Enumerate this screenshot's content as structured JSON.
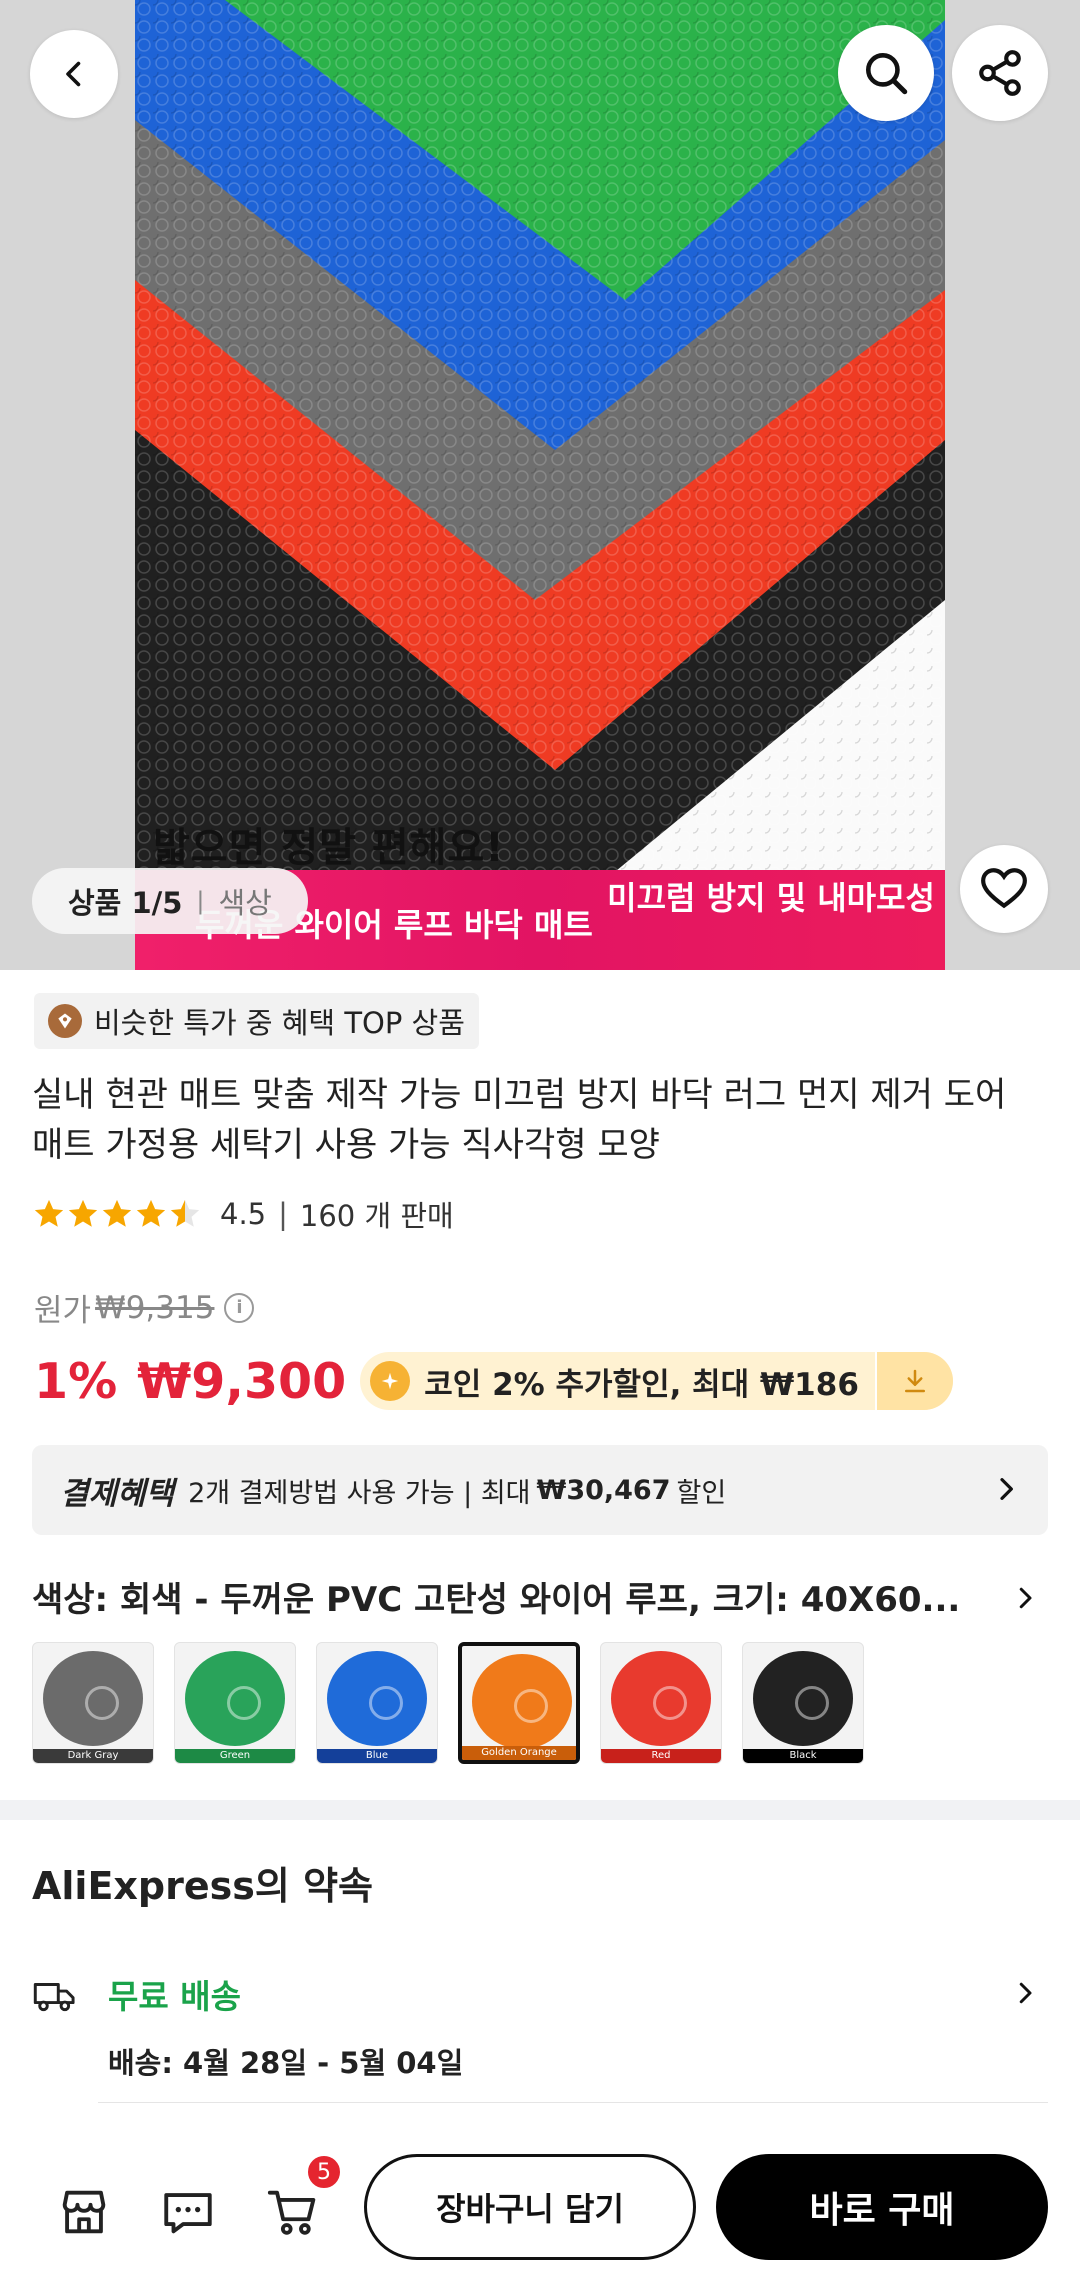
{
  "hero": {
    "overlay_text": "밟으면 정말 편해요!",
    "banner_left": "두꺼운 와이어 루프 바닥 매트",
    "banner_right": "미끄럼 방지 및 내마모성",
    "counter_current": "상품 1/5",
    "counter_other": "색상",
    "mat_colors": [
      "#2bb24a",
      "#1e63d6",
      "#6f6f6f",
      "#ef3b23",
      "#202020"
    ]
  },
  "product": {
    "tag": "비슷한 특가 중 혜택 TOP 상품",
    "title": "실내 현관 매트 맞춤 제작 가능 미끄럼 방지 바닥 러그 먼지 제거 도어 매트 가정용 세탁기 사용 가능 직사각형 모양",
    "rating": "4.5",
    "rating_stars": 4.5,
    "sold": "160 개 판매",
    "original_label": "원가",
    "original_price": "₩9,315",
    "discount": "1%",
    "price": "₩9,300",
    "coin_text": "코인 2% 추가할인, 최대 ₩186"
  },
  "payment": {
    "title": "결제혜택",
    "text": "2개 결제방법 사용 가능 | 최대",
    "amount": "₩30,467",
    "suffix": "할인"
  },
  "variant": {
    "label": "색상: 회색 - 두꺼운 PVC 고탄성 와이어 루프, 크기: 40X60...",
    "swatches": [
      {
        "name": "Dark Gray",
        "color": "#6b6b6b",
        "cap": "#3a3a3a"
      },
      {
        "name": "Green",
        "color": "#29a35a",
        "cap": "#1d8a45"
      },
      {
        "name": "Blue",
        "color": "#1f6bd9",
        "cap": "#14409a"
      },
      {
        "name": "Golden Orange",
        "color": "#f07a1a",
        "cap": "#c95e0a"
      },
      {
        "name": "Red",
        "color": "#e83a2e",
        "cap": "#c8211b"
      },
      {
        "name": "Black",
        "color": "#222222",
        "cap": "#000000"
      }
    ],
    "selected_index": 3
  },
  "promise": {
    "title": "AliExpress의 약속",
    "free_shipping": "무료 배송",
    "delivery": "배송: 4월 28일 - 5월 04일"
  },
  "bottom": {
    "cart_badge": "5",
    "add_to_cart": "장바구니 담기",
    "buy_now": "바로 구매"
  },
  "colors": {
    "price_red": "#e3233a",
    "free_green": "#1aa34a",
    "banner_pink": "#e21463"
  }
}
